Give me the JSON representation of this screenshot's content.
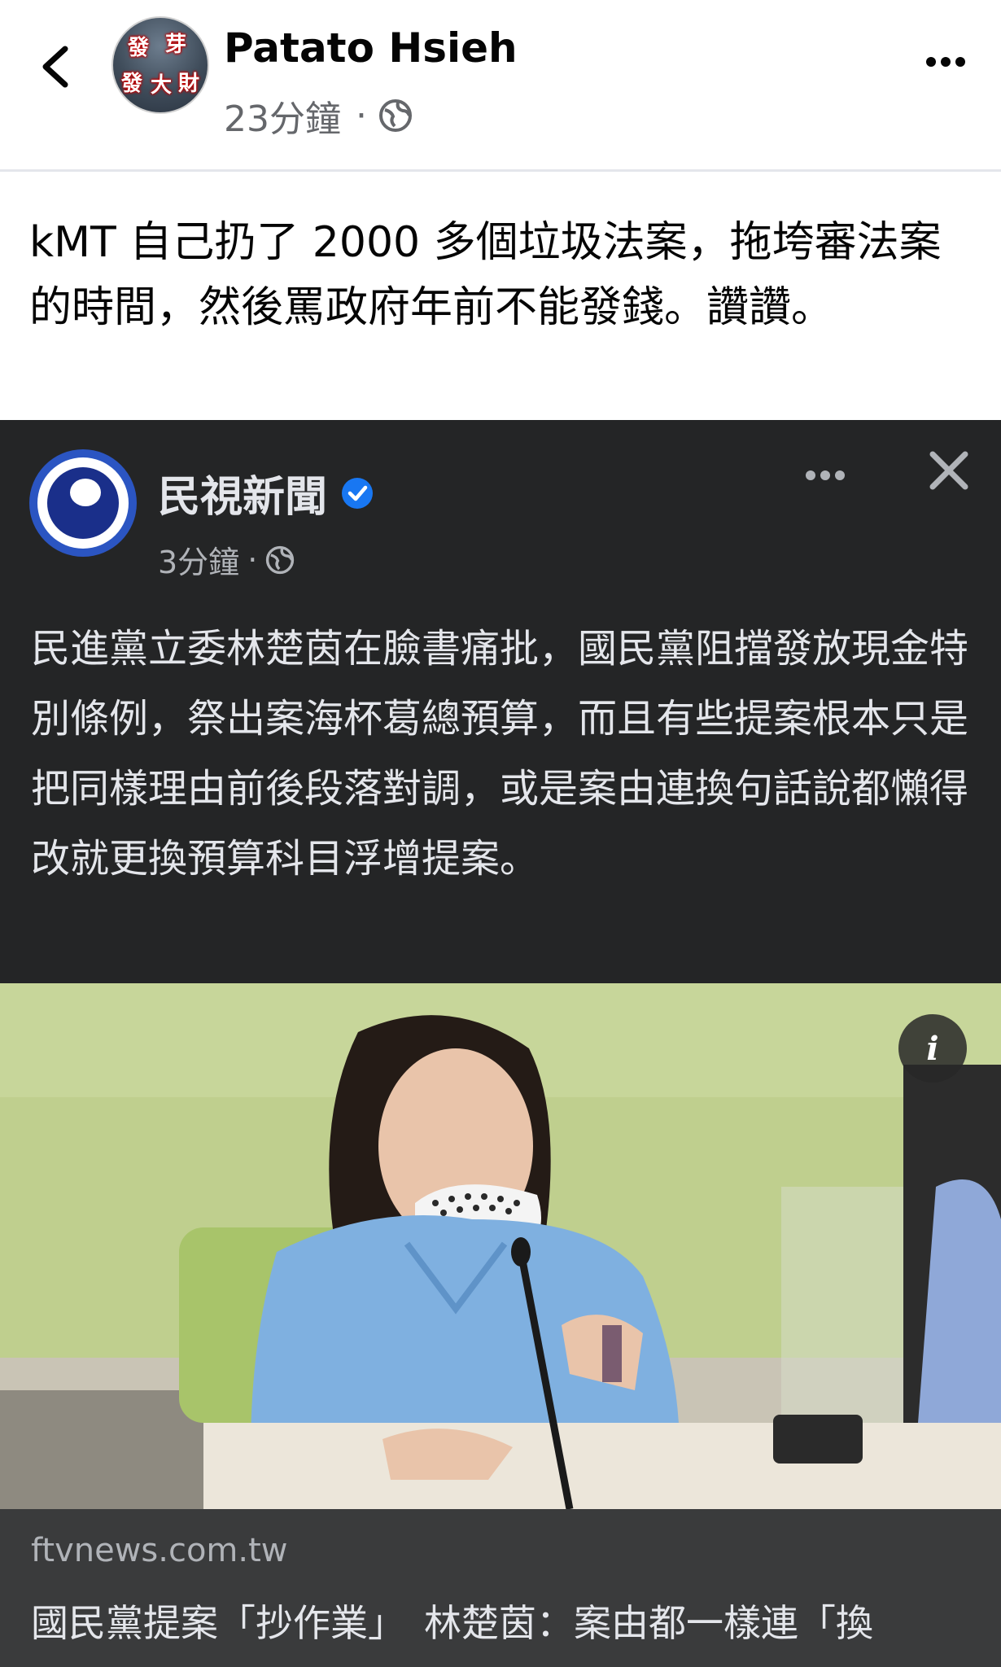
{
  "header": {
    "back_icon": "chevron-left-icon",
    "avatar_text": [
      "發",
      "芽",
      "發",
      "大",
      "財"
    ],
    "author": "Patato Hsieh",
    "time": "23分鐘",
    "separator": "·",
    "audience_icon": "globe-icon",
    "more_icon": "more-horizontal-icon"
  },
  "post": {
    "text": "kMT 自己扔了 2000 多個垃圾法案，拖垮審法案的時間，然後罵政府年前不能發錢。讚讚。"
  },
  "shared": {
    "page_name": "民視新聞",
    "verified_icon": "verified-badge-icon",
    "time": "3分鐘",
    "separator": "·",
    "audience_icon": "globe-icon",
    "more_icon": "more-horizontal-icon",
    "close_icon": "close-icon",
    "text": "民進黨立委林楚茵在臉書痛批，國民黨阻擋發放現金特別條例，祭出案海杯葛總預算，而且有些提案根本只是把同樣理由前後段落對調，或是案由連換句話說都懶得改就更換預算科目浮增提案。",
    "info_label": "i"
  },
  "link": {
    "domain": "ftvnews.com.tw",
    "headline": "國民黨提案「抄作業」　林楚茵：案由都一樣連「換"
  },
  "colors": {
    "dark_bg": "#242526",
    "link_bg": "#3a3b3c",
    "meta_gray": "#65676b",
    "verified_blue": "#1877f2"
  }
}
